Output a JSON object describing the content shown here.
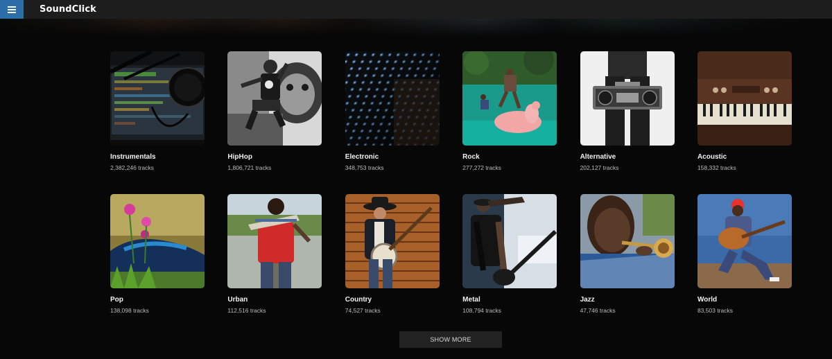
{
  "app": {
    "name": "SoundClick"
  },
  "colors": {
    "accent": "#2b6ea8",
    "topbar": "#1d1d1d",
    "background": "#070707"
  },
  "icons": {
    "menu": "hamburger-menu-icon"
  },
  "genres": [
    {
      "title": "Instrumentals",
      "count": "2,382,246 tracks"
    },
    {
      "title": "HipHop",
      "count": "1,806,721 tracks"
    },
    {
      "title": "Electronic",
      "count": "348,753 tracks"
    },
    {
      "title": "Rock",
      "count": "277,272 tracks"
    },
    {
      "title": "Alternative",
      "count": "202,127 tracks"
    },
    {
      "title": "Acoustic",
      "count": "158,332 tracks"
    },
    {
      "title": "Pop",
      "count": "138,098 tracks"
    },
    {
      "title": "Urban",
      "count": "112,516 tracks"
    },
    {
      "title": "Country",
      "count": "74,527 tracks"
    },
    {
      "title": "Metal",
      "count": "108,794 tracks"
    },
    {
      "title": "Jazz",
      "count": "47,746 tracks"
    },
    {
      "title": "World",
      "count": "83,503 tracks"
    }
  ],
  "actions": {
    "show_more": "SHOW MORE"
  }
}
